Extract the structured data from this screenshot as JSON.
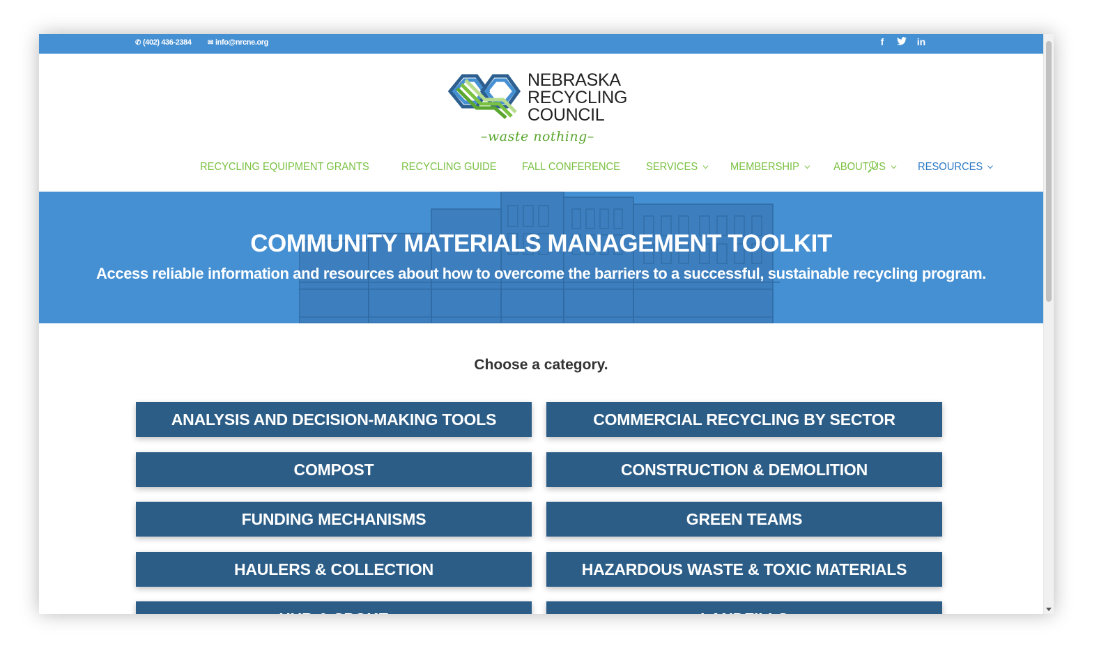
{
  "topbar": {
    "phone": "(402) 436-2384",
    "email": "info@nrcne.org",
    "social": [
      "f",
      "twitter-bird",
      "in"
    ]
  },
  "logo": {
    "line1": "NEBRASKA",
    "line2": "RECYCLING",
    "line3": "COUNCIL",
    "tagline": "–waste nothing–"
  },
  "nav": {
    "items": [
      {
        "label": "RECYCLING EQUIPMENT GRANTS",
        "has_dropdown": false
      },
      {
        "label": "RECYCLING GUIDE",
        "has_dropdown": false
      },
      {
        "label": "FALL CONFERENCE",
        "has_dropdown": false
      },
      {
        "label": "SERVICES",
        "has_dropdown": true
      },
      {
        "label": "MEMBERSHIP",
        "has_dropdown": true
      },
      {
        "label": "ABOUT US",
        "has_dropdown": true
      },
      {
        "label": "RESOURCES",
        "has_dropdown": true,
        "active": true
      }
    ]
  },
  "hero": {
    "title": "COMMUNITY MATERIALS MANAGEMENT TOOLKIT",
    "subtitle": "Access reliable information and resources about how to overcome the barriers to a successful, sustainable recycling program."
  },
  "main": {
    "prompt": "Choose a category.",
    "categories": [
      "ANALYSIS AND DECISION-MAKING TOOLS",
      "COMMERCIAL RECYCLING BY SECTOR",
      "COMPOST",
      "CONSTRUCTION & DEMOLITION",
      "FUNDING MECHANISMS",
      "GREEN TEAMS",
      "HAULERS & COLLECTION",
      "HAZARDOUS WASTE & TOXIC MATERIALS",
      "HUB & SPOKE",
      "LANDFILLS"
    ]
  },
  "colors": {
    "topbar": "#4590d3",
    "nav_text": "#7ac142",
    "nav_active": "#2b78c3",
    "category_button": "#2b5d87"
  }
}
